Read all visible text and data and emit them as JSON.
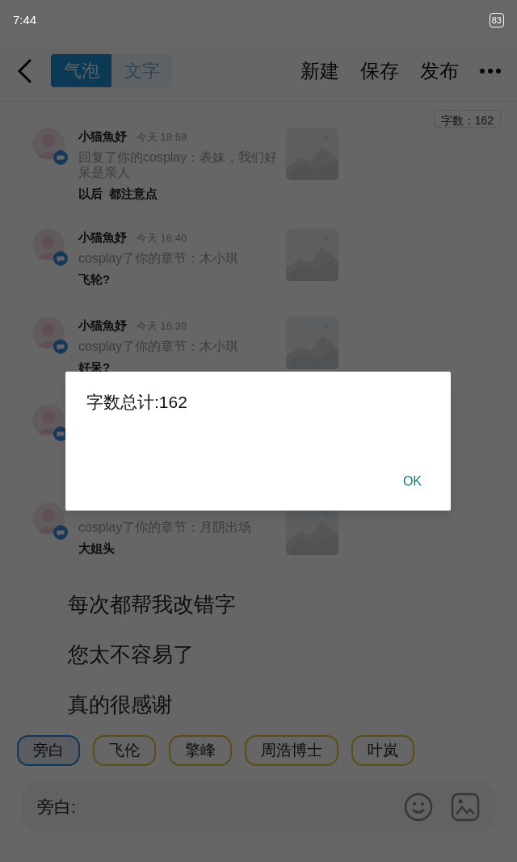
{
  "status_bar": {
    "time": "7:44",
    "battery": "83"
  },
  "toolbar": {
    "tabs": [
      {
        "label": "气泡",
        "selected": true
      },
      {
        "label": "文字",
        "selected": false
      }
    ],
    "actions": [
      "新建",
      "保存",
      "发布"
    ]
  },
  "word_count_badge": "字数：162",
  "messages": [
    {
      "kind": "full",
      "name": "小猫魚妤",
      "time": "今天 18:59",
      "summary": "回复了你的cosplay：表妹，我们好呆是亲人",
      "reply": "以后  都注意点"
    },
    {
      "kind": "full",
      "name": "小猫魚妤",
      "time": "今天 16:40",
      "summary": "cosplay了你的章节：木小琪",
      "reply": "飞轮?"
    },
    {
      "kind": "full",
      "name": "小猫魚妤",
      "time": "今天 16:39",
      "summary": "cosplay了你的章节：木小琪",
      "reply": "好呆?"
    },
    {
      "kind": "covered"
    },
    {
      "kind": "no_header",
      "summary": "cosplay了你的章节：月阴出场",
      "reply": "大姐头"
    }
  ],
  "lines": [
    "每次都帮我改错字",
    "您太不容易了",
    "真的很感谢"
  ],
  "speakers": [
    {
      "label": "旁白",
      "selected": true
    },
    {
      "label": "飞伦",
      "selected": false
    },
    {
      "label": "擎峰",
      "selected": false
    },
    {
      "label": "周浩博士",
      "selected": false
    },
    {
      "label": "叶岚",
      "selected": false
    }
  ],
  "input": {
    "label": "旁白:"
  },
  "dialog": {
    "message": "字数总计:162",
    "button": "OK"
  }
}
